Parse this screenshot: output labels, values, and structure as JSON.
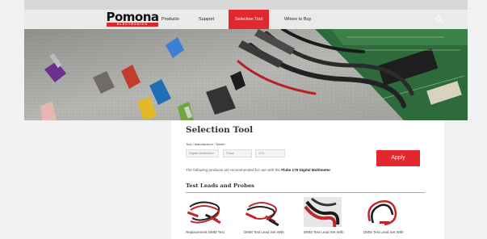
{
  "brand": {
    "name": "Pomona",
    "tagline": "ELECTRONICS"
  },
  "nav": {
    "items": [
      {
        "label": "Products"
      },
      {
        "label": "Support"
      },
      {
        "label": "Selection Tool",
        "active": true
      },
      {
        "label": "Where to Buy"
      }
    ],
    "search_icon": "search-icon"
  },
  "colors": {
    "accent": "#e2272e",
    "page_bg": "#f1f1f1"
  },
  "selection": {
    "title": "Selection Tool",
    "filter_label": "Tool / Manufacturer / Model",
    "fields": [
      "Digital Multimeter",
      "Fluke",
      "179"
    ],
    "apply_label": "Apply",
    "recommendation_prefix": "The following products are recommended for use with the ",
    "recommendation_product": "Fluke 179 Digital Multimeter",
    "recommendation_suffix": ":"
  },
  "section": {
    "title": "Test Leads and Probes",
    "products": [
      {
        "name": "Replacement DMM Test"
      },
      {
        "name": "DMM Test Lead Set With"
      },
      {
        "name": "DMM Test Lead Set With"
      },
      {
        "name": "DMM Test Lead Set With"
      }
    ]
  }
}
